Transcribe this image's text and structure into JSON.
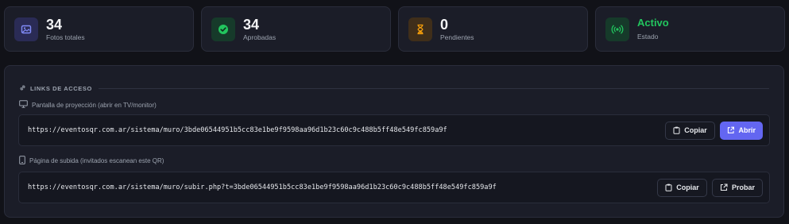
{
  "colors": {
    "accent": "#6366f1",
    "success": "#22c55e",
    "warning": "#f59e0b",
    "info": "#818cf8"
  },
  "stats": [
    {
      "value": "34",
      "label": "Fotos totales",
      "icon": "image-icon"
    },
    {
      "value": "34",
      "label": "Aprobadas",
      "icon": "check-circle-icon"
    },
    {
      "value": "0",
      "label": "Pendientes",
      "icon": "hourglass-icon"
    },
    {
      "value": "Activo",
      "label": "Estado",
      "icon": "broadcast-icon"
    }
  ],
  "links": {
    "title": "LINKS DE ACCESO",
    "projection": {
      "label": "Pantalla de proyección (abrir en TV/monitor)",
      "url": "https://eventosqr.com.ar/sistema/muro/3bde06544951b5cc83e1be9f9598aa96d1b23c60c9c488b5ff48e549fc859a9f",
      "copy_label": "Copiar",
      "open_label": "Abrir"
    },
    "upload": {
      "label": "Página de subida (invitados escanean este QR)",
      "url": "https://eventosqr.com.ar/sistema/muro/subir.php?t=3bde06544951b5cc83e1be9f9598aa96d1b23c60c9c488b5ff48e549fc859a9f",
      "copy_label": "Copiar",
      "test_label": "Probar"
    }
  }
}
